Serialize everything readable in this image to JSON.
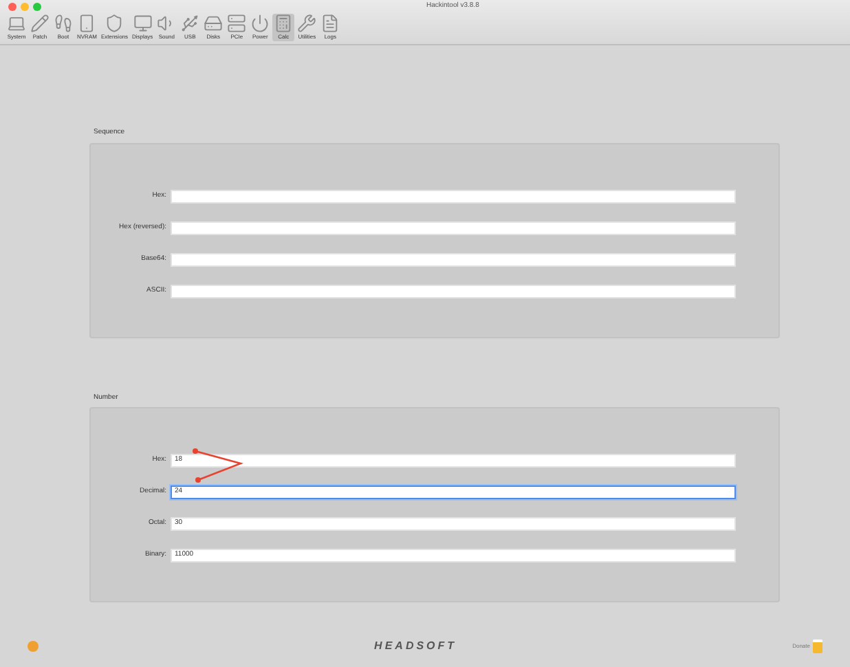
{
  "window": {
    "title": "Hackintool v3.8.8"
  },
  "toolbar": [
    {
      "label": "System",
      "selected": false
    },
    {
      "label": "Patch",
      "selected": false
    },
    {
      "label": "Boot",
      "selected": false
    },
    {
      "label": "NVRAM",
      "selected": false
    },
    {
      "label": "Extensions",
      "selected": false
    },
    {
      "label": "Displays",
      "selected": false
    },
    {
      "label": "Sound",
      "selected": false
    },
    {
      "label": "USB",
      "selected": false
    },
    {
      "label": "Disks",
      "selected": false
    },
    {
      "label": "PCIe",
      "selected": false
    },
    {
      "label": "Power",
      "selected": false
    },
    {
      "label": "Calc",
      "selected": true
    },
    {
      "label": "Utilities",
      "selected": false
    },
    {
      "label": "Logs",
      "selected": false
    }
  ],
  "groups": [
    {
      "title": "Sequence",
      "fields": [
        {
          "label": "Hex:",
          "focused": false
        },
        {
          "label": "Hex (reversed):",
          "focused": false
        },
        {
          "label": "Base64:",
          "focused": false
        },
        {
          "label": "ASCII:",
          "focused": false
        }
      ]
    },
    {
      "title": "Number",
      "fields": [
        {
          "label": "Hex:",
          "value": "18",
          "focused": false
        },
        {
          "label": "Decimal:",
          "value": "24",
          "focused": true
        },
        {
          "label": "Octal:",
          "value": "30",
          "focused": false
        },
        {
          "label": "Binary:",
          "value": "11000",
          "focused": false
        }
      ]
    }
  ],
  "footer": {
    "logo": "HEADSOFT",
    "donate": "Donate"
  }
}
